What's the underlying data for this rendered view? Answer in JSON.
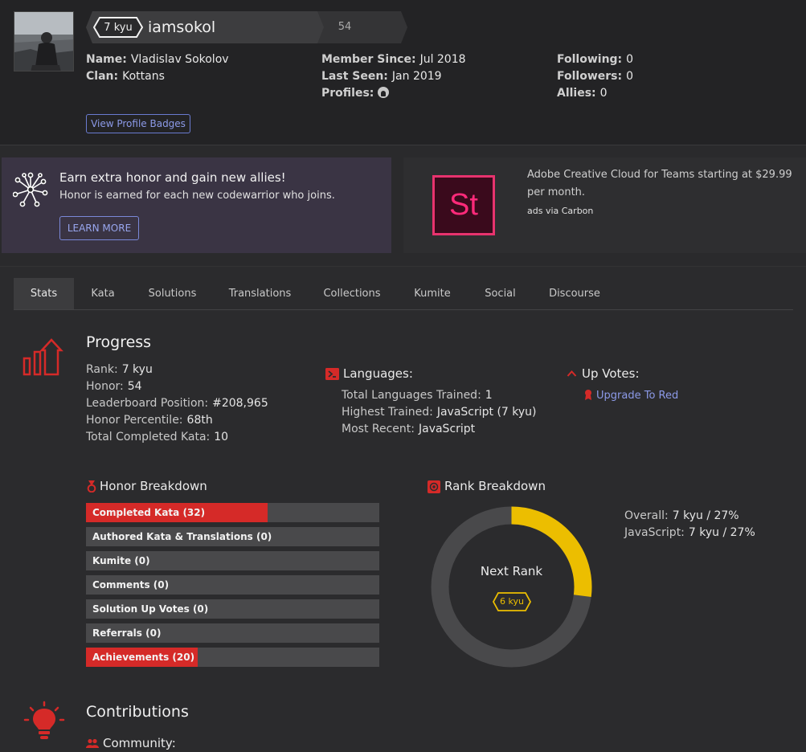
{
  "profile": {
    "rank_badge": "7 kyu",
    "username": "iamsokol",
    "honor": "54",
    "col1": [
      {
        "key": "Name:",
        "value": "Vladislav Sokolov"
      },
      {
        "key": "Clan:",
        "value": "Kottans"
      }
    ],
    "col2": [
      {
        "key": "Member Since:",
        "value": "Jul 2018"
      },
      {
        "key": "Last Seen:",
        "value": "Jan 2019"
      },
      {
        "key": "Profiles:",
        "value": ""
      }
    ],
    "col3": [
      {
        "key": "Following:",
        "value": "0"
      },
      {
        "key": "Followers:",
        "value": "0"
      },
      {
        "key": "Allies:",
        "value": "0"
      }
    ],
    "view_badges_label": "View Profile Badges",
    "profile_icon": "github-icon"
  },
  "promo": {
    "title": "Earn extra honor and gain new allies!",
    "subtitle": "Honor is earned for each new codewarrior who joins.",
    "button_label": "LEARN MORE"
  },
  "ad": {
    "logo_text": "St",
    "text": "Adobe Creative Cloud for Teams starting at $29.99 per month.",
    "via": "ads via Carbon"
  },
  "tabs": [
    "Stats",
    "Kata",
    "Solutions",
    "Translations",
    "Collections",
    "Kumite",
    "Social",
    "Discourse"
  ],
  "progress": {
    "title": "Progress",
    "stats": [
      {
        "key": "Rank:",
        "value": "7 kyu"
      },
      {
        "key": "Honor:",
        "value": "54"
      },
      {
        "key": "Leaderboard Position:",
        "value": "#208,965"
      },
      {
        "key": "Honor Percentile:",
        "value": "68th"
      },
      {
        "key": "Total Completed Kata:",
        "value": "10"
      }
    ],
    "languages": {
      "title": "Languages:",
      "stats": [
        {
          "key": "Total Languages Trained:",
          "value": "1"
        },
        {
          "key": "Highest Trained:",
          "value": "JavaScript (7 kyu)"
        },
        {
          "key": "Most Recent:",
          "value": "JavaScript"
        }
      ]
    },
    "upvotes": {
      "title": "Up Votes:",
      "link": "Upgrade To Red"
    }
  },
  "honor_breakdown": {
    "title": "Honor Breakdown",
    "bars": [
      {
        "label": "Completed Kata (32)",
        "fraction": 0.62
      },
      {
        "label": "Authored Kata & Translations (0)",
        "fraction": 0
      },
      {
        "label": "Kumite (0)",
        "fraction": 0
      },
      {
        "label": "Comments (0)",
        "fraction": 0
      },
      {
        "label": "Solution Up Votes (0)",
        "fraction": 0
      },
      {
        "label": "Referrals (0)",
        "fraction": 0
      },
      {
        "label": "Achievements (20)",
        "fraction": 0.38
      }
    ]
  },
  "rank_breakdown": {
    "title": "Rank Breakdown",
    "center_label": "Next Rank",
    "next_rank": "6 kyu",
    "progress_fraction": 0.27,
    "stats": [
      {
        "key": "Overall:",
        "value": "7 kyu / 27%"
      },
      {
        "key": "JavaScript:",
        "value": "7 kyu / 27%"
      }
    ]
  },
  "contributions": {
    "title": "Contributions",
    "community_label": "Community:"
  },
  "colors": {
    "accent_red": "#d52a28",
    "rank_yellow": "#ecbe00",
    "link_blue": "#8c9ae8",
    "adobe_pink": "#e8336e"
  }
}
